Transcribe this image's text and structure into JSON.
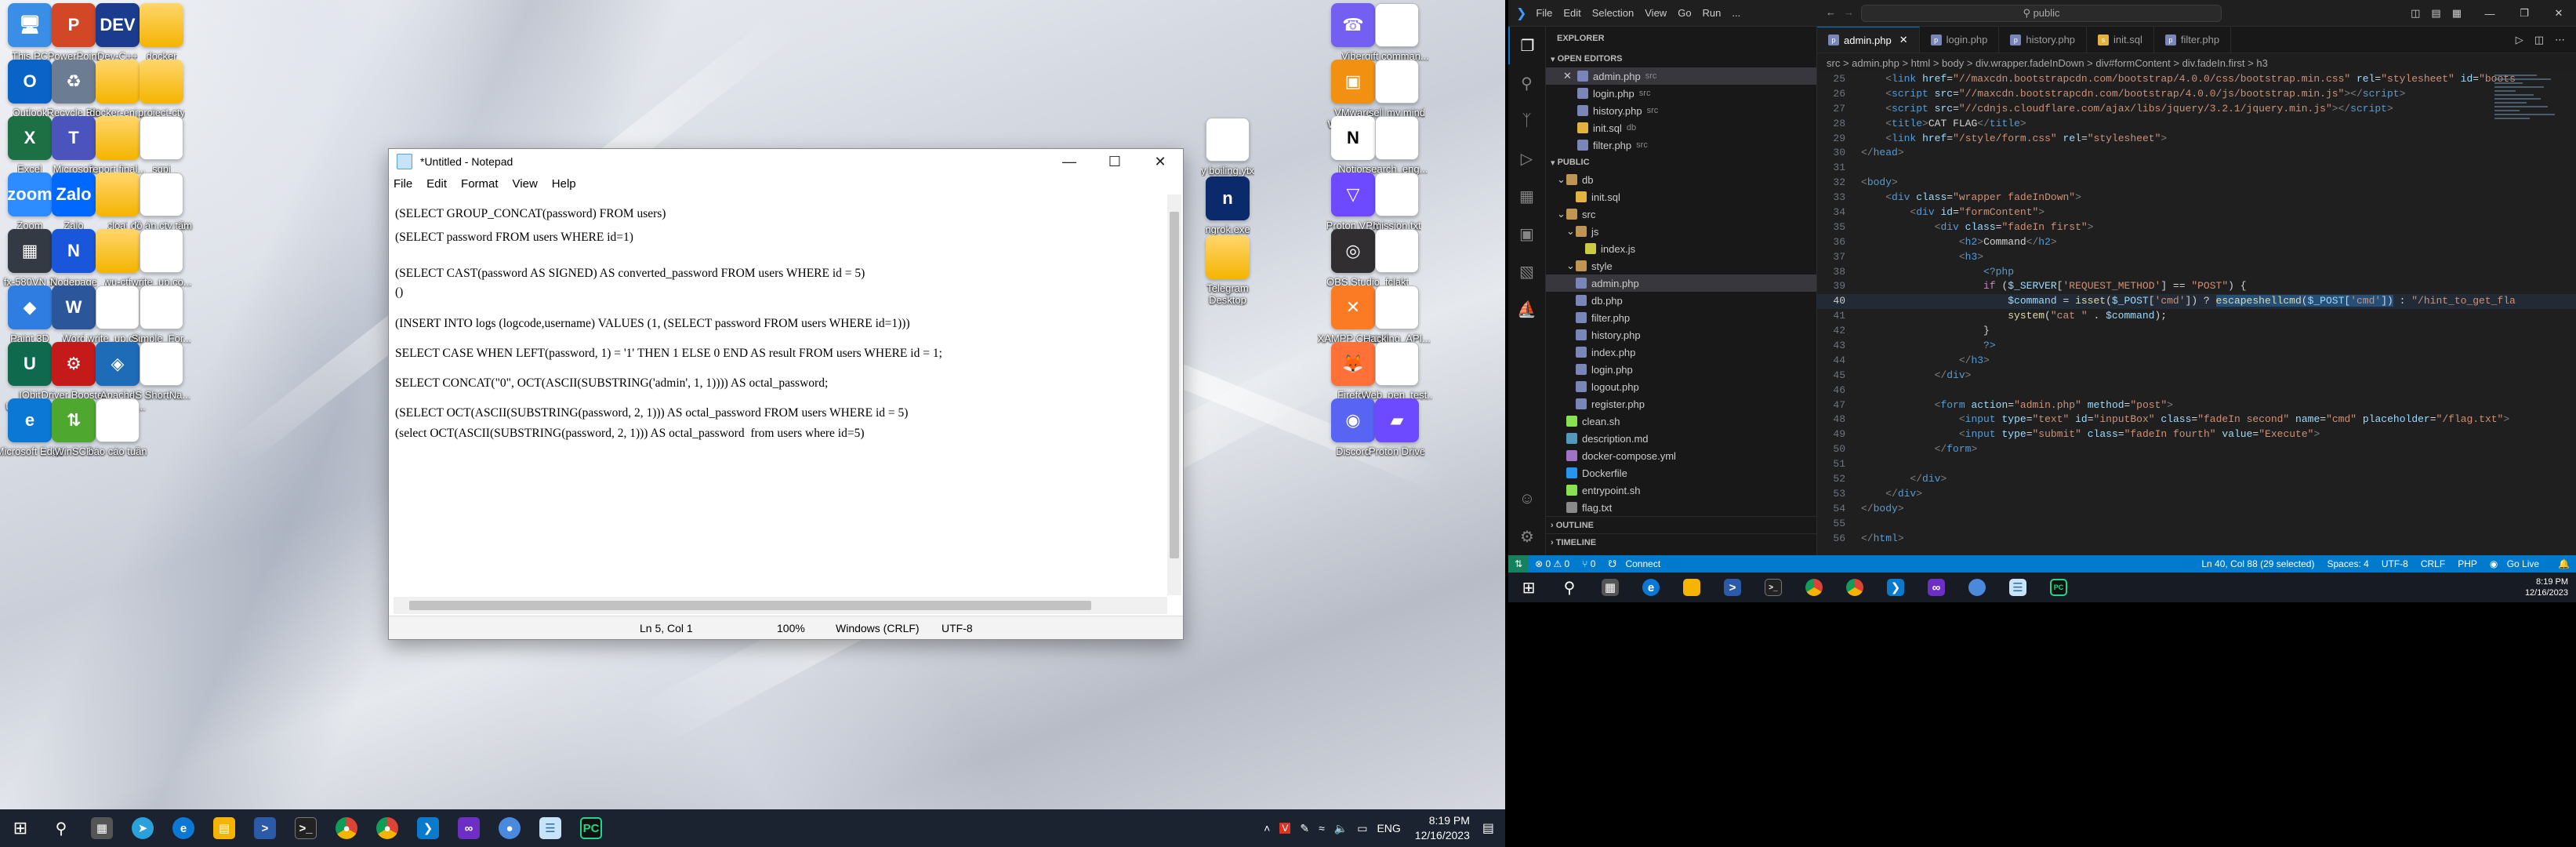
{
  "desktop": {
    "icons_left": [
      {
        "label": "This PC",
        "color": "#3a8ee6",
        "glyph": "🖥"
      },
      {
        "label": "PowerPoint",
        "color": "#d24726",
        "glyph": "P"
      },
      {
        "label": "Dev-C++",
        "color": "#1b3b8f",
        "glyph": "DEV"
      },
      {
        "label": "docker",
        "color": "folder",
        "glyph": ""
      },
      {
        "label": "Outlook",
        "color": "#0a64c8",
        "glyph": "O"
      },
      {
        "label": "Recycle Bin",
        "color": "#6b7c93",
        "glyph": "♻"
      },
      {
        "label": "docker-enj...",
        "color": "folder",
        "glyph": ""
      },
      {
        "label": "project-cty",
        "color": "folder",
        "glyph": ""
      },
      {
        "label": "Excel",
        "color": "#1d7044",
        "glyph": "X"
      },
      {
        "label": "Microsoft Teams classic",
        "color": "#4b53bc",
        "glyph": "T"
      },
      {
        "label": "report final...",
        "color": "folder",
        "glyph": ""
      },
      {
        "label": "sqpi",
        "color": "doc",
        "glyph": ""
      },
      {
        "label": "Zoom",
        "color": "#2d8cff",
        "glyph": "zoom"
      },
      {
        "label": "Zalo",
        "color": "#0068ff",
        "glyph": "Zalo"
      },
      {
        "label": "cloai",
        "color": "folder",
        "glyph": ""
      },
      {
        "label": "đồ án cty tấm duan",
        "color": "doc",
        "glyph": ""
      },
      {
        "label": "fx-580VN X Emulator",
        "color": "#333a44",
        "glyph": "▦"
      },
      {
        "label": "Nodepage",
        "color": "#1a56db",
        "glyph": "N"
      },
      {
        "label": "wu-ctf",
        "color": "folder",
        "glyph": ""
      },
      {
        "label": "write_up co...",
        "color": "doc",
        "glyph": ""
      },
      {
        "label": "Paint 3D",
        "color": "#2f7de1",
        "glyph": "◆"
      },
      {
        "label": "Word",
        "color": "#2b579a",
        "glyph": "W"
      },
      {
        "label": "write_up co...",
        "color": "doc",
        "glyph": ""
      },
      {
        "label": "Simple_For...",
        "color": "doc",
        "glyph": ""
      },
      {
        "label": "IObit Uninstaller",
        "color": "#0f6a4d",
        "glyph": "U"
      },
      {
        "label": "Driver Booster 10",
        "color": "#c41a1a",
        "glyph": "⚙"
      },
      {
        "label": "Apache NetBeans ...",
        "color": "#1e6bb8",
        "glyph": "◈"
      },
      {
        "label": "IS ShortNa...",
        "color": "doc",
        "glyph": ""
      },
      {
        "label": "Microsoft Edge",
        "color": "#0c78d6",
        "glyph": "e"
      },
      {
        "label": "WinSCP",
        "color": "#4ea72e",
        "glyph": "⇅"
      },
      {
        "label": "báo cáo tuần",
        "color": "doc",
        "glyph": ""
      }
    ],
    "icons_right": [
      {
        "label": "Viber",
        "color": "#7360f2",
        "glyph": "☎"
      },
      {
        "label": "gift comman...",
        "color": "doc",
        "glyph": ""
      },
      {
        "label": "VMware Workstati...",
        "color": "#f29111",
        "glyph": "▣"
      },
      {
        "label": "sell my mind",
        "color": "doc",
        "glyph": ""
      },
      {
        "label": "Notion",
        "color": "#ffffff",
        "glyph": "N"
      },
      {
        "label": "search_eng...",
        "color": "doc",
        "glyph": ""
      },
      {
        "label": "Proton VPN",
        "color": "#6d4aff",
        "glyph": "▽"
      },
      {
        "label": "mission.txt",
        "color": "doc",
        "glyph": ""
      },
      {
        "label": "OBS Studio",
        "color": "#302e31",
        "glyph": "◎"
      },
      {
        "label": "fclakt",
        "color": "doc",
        "glyph": ""
      },
      {
        "label": "XAMPP Control Panel",
        "color": "#fb7a24",
        "glyph": "✕"
      },
      {
        "label": "Hacking_API...",
        "color": "doc",
        "glyph": ""
      },
      {
        "label": "Firefox",
        "color": "#ff7139",
        "glyph": "🦊"
      },
      {
        "label": "Web_pen_test...",
        "color": "doc",
        "glyph": ""
      },
      {
        "label": "Discord",
        "color": "#5865f2",
        "glyph": "◉"
      },
      {
        "label": "Proton Drive",
        "color": "#6d4aff",
        "glyph": "▰"
      }
    ],
    "icons_mid": [
      {
        "label": "y boiling.ytx",
        "color": "doc",
        "glyph": ""
      },
      {
        "label": "ngrok.exe",
        "color": "#0b2a6b",
        "glyph": "n"
      },
      {
        "label": "Telegram Desktop",
        "color": "folder",
        "glyph": ""
      }
    ]
  },
  "notepad": {
    "title": "*Untitled - Notepad",
    "menu": [
      "File",
      "Edit",
      "Format",
      "View",
      "Help"
    ],
    "lines": [
      "(SELECT GROUP_CONCAT(password) FROM users)",
      "(SELECT password FROM users WHERE id=1)",
      "(SELECT CAST(password AS SIGNED) AS converted_password FROM users WHERE id = 5)",
      "()",
      "(INSERT INTO logs (logcode,username) VALUES (1, (SELECT password FROM users WHERE id=1)))",
      "SELECT CASE WHEN LEFT(password, 1) = '1' THEN 1 ELSE 0 END AS result FROM users WHERE id = 1;",
      "SELECT CONCAT(\"0\", OCT(ASCII(SUBSTRING('admin', 1, 1)))) AS octal_password;",
      "(SELECT OCT(ASCII(SUBSTRING(password, 2, 1))) AS octal_password FROM users WHERE id = 5)",
      "(select OCT(ASCII(SUBSTRING(password, 2, 1))) AS octal_password  from users where id=5)"
    ],
    "status": {
      "position": "Ln 5, Col 1",
      "zoom": "100%",
      "eol": "Windows (CRLF)",
      "encoding": "UTF-8"
    }
  },
  "taskbar_left": {
    "lang": "ENG",
    "time": "8:19 PM",
    "date": "12/16/2023"
  },
  "vscode": {
    "menu": [
      "File",
      "Edit",
      "Selection",
      "View",
      "Go",
      "Run",
      "..."
    ],
    "search": "public",
    "explorer_title": "EXPLORER",
    "open_editors_header": "OPEN EDITORS",
    "open_editors": [
      {
        "name": "admin.php",
        "dir": "src"
      },
      {
        "name": "login.php",
        "dir": "src"
      },
      {
        "name": "history.php",
        "dir": "src"
      },
      {
        "name": "init.sql",
        "dir": "db"
      },
      {
        "name": "filter.php",
        "dir": "src"
      }
    ],
    "public_header": "PUBLIC",
    "tree": [
      {
        "name": "db",
        "kind": "folder",
        "depth": 0
      },
      {
        "name": "init.sql",
        "kind": "sql",
        "depth": 1
      },
      {
        "name": "src",
        "kind": "folder",
        "depth": 0
      },
      {
        "name": "js",
        "kind": "folder",
        "depth": 1
      },
      {
        "name": "index.js",
        "kind": "js",
        "depth": 2
      },
      {
        "name": "style",
        "kind": "folder",
        "depth": 1
      },
      {
        "name": "admin.php",
        "kind": "php",
        "depth": 1
      },
      {
        "name": "db.php",
        "kind": "php",
        "depth": 1
      },
      {
        "name": "filter.php",
        "kind": "php",
        "depth": 1
      },
      {
        "name": "history.php",
        "kind": "php",
        "depth": 1
      },
      {
        "name": "index.php",
        "kind": "php",
        "depth": 1
      },
      {
        "name": "login.php",
        "kind": "php",
        "depth": 1
      },
      {
        "name": "logout.php",
        "kind": "php",
        "depth": 1
      },
      {
        "name": "register.php",
        "kind": "php",
        "depth": 1
      },
      {
        "name": "clean.sh",
        "kind": "sh",
        "depth": 0
      },
      {
        "name": "description.md",
        "kind": "md",
        "depth": 0
      },
      {
        "name": "docker-compose.yml",
        "kind": "yml",
        "depth": 0
      },
      {
        "name": "Dockerfile",
        "kind": "docker",
        "depth": 0
      },
      {
        "name": "entrypoint.sh",
        "kind": "sh",
        "depth": 0
      },
      {
        "name": "flag.txt",
        "kind": "txt",
        "depth": 0
      }
    ],
    "outline": "OUTLINE",
    "timeline": "TIMELINE",
    "tabs": [
      "admin.php",
      "login.php",
      "history.php",
      "init.sql",
      "filter.php"
    ],
    "breadcrumb": "src > admin.php > html > body > div.wrapper.fadeInDown > div#formContent > div.fadeIn.first > h3",
    "code": [
      {
        "n": "25",
        "html": "<span class='w'>    </span><span class='p'>&lt;</span><span class='t'>link</span> <span class='a'>href</span>=<span class='s'>\"//maxcdn.bootstrapcdn.com/bootstrap/4.0.0/css/bootstrap.min.css\"</span> <span class='a'>rel</span>=<span class='s'>\"stylesheet\"</span> <span class='a'>id</span>=<span class='s'>\"boots</span>"
      },
      {
        "n": "26",
        "html": "<span class='w'>    </span><span class='p'>&lt;</span><span class='t'>script</span> <span class='a'>src</span>=<span class='s'>\"//maxcdn.bootstrapcdn.com/bootstrap/4.0.0/js/bootstrap.min.js\"</span><span class='p'>&gt;&lt;/</span><span class='t'>script</span><span class='p'>&gt;</span>"
      },
      {
        "n": "27",
        "html": "<span class='w'>    </span><span class='p'>&lt;</span><span class='t'>script</span> <span class='a'>src</span>=<span class='s'>\"//cdnjs.cloudflare.com/ajax/libs/jquery/3.2.1/jquery.min.js\"</span><span class='p'>&gt;&lt;/</span><span class='t'>script</span><span class='p'>&gt;</span>"
      },
      {
        "n": "28",
        "html": "<span class='w'>    </span><span class='p'>&lt;</span><span class='t'>title</span><span class='p'>&gt;</span><span class='w'>CAT FLAG</span><span class='p'>&lt;/</span><span class='t'>title</span><span class='p'>&gt;</span>"
      },
      {
        "n": "29",
        "html": "<span class='w'>    </span><span class='p'>&lt;</span><span class='t'>link</span> <span class='a'>href</span>=<span class='s'>\"/style/form.css\"</span> <span class='a'>rel</span>=<span class='s'>\"stylesheet\"</span><span class='p'>&gt;</span>"
      },
      {
        "n": "30",
        "html": "<span class='p'>&lt;/</span><span class='t'>head</span><span class='p'>&gt;</span>"
      },
      {
        "n": "31",
        "html": ""
      },
      {
        "n": "32",
        "html": "<span class='p'>&lt;</span><span class='t'>body</span><span class='p'>&gt;</span>"
      },
      {
        "n": "33",
        "html": "<span class='w'>    </span><span class='p'>&lt;</span><span class='t'>div</span> <span class='a'>class</span>=<span class='s'>\"wrapper fadeInDown\"</span><span class='p'>&gt;</span>"
      },
      {
        "n": "34",
        "html": "<span class='w'>        </span><span class='p'>&lt;</span><span class='t'>div</span> <span class='a'>id</span>=<span class='s'>\"formContent\"</span><span class='p'>&gt;</span>"
      },
      {
        "n": "35",
        "html": "<span class='w'>            </span><span class='p'>&lt;</span><span class='t'>div</span> <span class='a'>class</span>=<span class='s'>\"fadeIn first\"</span><span class='p'>&gt;</span>"
      },
      {
        "n": "36",
        "html": "<span class='w'>                </span><span class='p'>&lt;</span><span class='t'>h2</span><span class='p'>&gt;</span><span class='w'>Command</span><span class='p'>&lt;/</span><span class='t'>h2</span><span class='p'>&gt;</span>"
      },
      {
        "n": "37",
        "html": "<span class='w'>                </span><span class='p'>&lt;</span><span class='t'>h3</span><span class='p'>&gt;</span>"
      },
      {
        "n": "38",
        "html": "<span class='w'>                    </span><span class='t'>&lt;?php</span>"
      },
      {
        "n": "39",
        "html": "<span class='w'>                    </span><span class='k'>if</span><span class='w'> (</span><span class='v'>$_SERVER</span><span class='w'>[</span><span class='s'>'REQUEST_METHOD'</span><span class='w'>] == </span><span class='s'>\"POST\"</span><span class='w'>) {</span>"
      },
      {
        "n": "40",
        "cur": true,
        "html": "<span class='w'>                        </span><span class='v'>$command</span><span class='w'> = </span><span class='f'>isset</span><span class='w'>(</span><span class='v'>$_POST</span><span class='w'>[</span><span class='s'>'cmd'</span><span class='w'>]) ? </span><span class='f' style='background:#264f78'>escapeshellcmd</span><span class='w' style='background:#264f78'>(</span><span class='v' style='background:#264f78'>$_POST</span><span class='w' style='background:#264f78'>[</span><span class='s' style='background:#264f78'>'cmd'</span><span class='w' style='background:#264f78'>])</span><span class='w'> : </span><span class='s'>\"/hint_to_get_fla</span>"
      },
      {
        "n": "41",
        "html": "<span class='w'>                        </span><span class='f'>system</span><span class='w'>(</span><span class='s'>\"cat \"</span><span class='w'> . </span><span class='v'>$command</span><span class='w'>);</span>"
      },
      {
        "n": "42",
        "html": "<span class='w'>                    }</span>"
      },
      {
        "n": "43",
        "html": "<span class='w'>                    </span><span class='t'>?&gt;</span>"
      },
      {
        "n": "44",
        "html": "<span class='w'>                </span><span class='p'>&lt;/</span><span class='t'>h3</span><span class='p'>&gt;</span>"
      },
      {
        "n": "45",
        "html": "<span class='w'>            </span><span class='p'>&lt;/</span><span class='t'>div</span><span class='p'>&gt;</span>"
      },
      {
        "n": "46",
        "html": ""
      },
      {
        "n": "47",
        "html": "<span class='w'>            </span><span class='p'>&lt;</span><span class='t'>form</span> <span class='a'>action</span>=<span class='s'>\"admin.php\"</span> <span class='a'>method</span>=<span class='s'>\"post\"</span><span class='p'>&gt;</span>"
      },
      {
        "n": "48",
        "html": "<span class='w'>                </span><span class='p'>&lt;</span><span class='t'>input</span> <span class='a'>type</span>=<span class='s'>\"text\"</span> <span class='a'>id</span>=<span class='s'>\"inputBox\"</span> <span class='a'>class</span>=<span class='s'>\"fadeIn second\"</span> <span class='a'>name</span>=<span class='s'>\"cmd\"</span> <span class='a'>placeholder</span>=<span class='s'>\"/flag.txt\"</span><span class='p'>&gt;</span>"
      },
      {
        "n": "49",
        "html": "<span class='w'>                </span><span class='p'>&lt;</span><span class='t'>input</span> <span class='a'>type</span>=<span class='s'>\"submit\"</span> <span class='a'>class</span>=<span class='s'>\"fadeIn fourth\"</span> <span class='a'>value</span>=<span class='s'>\"Execute\"</span><span class='p'>&gt;</span>"
      },
      {
        "n": "50",
        "html": "<span class='w'>            </span><span class='p'>&lt;/</span><span class='t'>form</span><span class='p'>&gt;</span>"
      },
      {
        "n": "51",
        "html": ""
      },
      {
        "n": "52",
        "html": "<span class='w'>        </span><span class='p'>&lt;/</span><span class='t'>div</span><span class='p'>&gt;</span>"
      },
      {
        "n": "53",
        "html": "<span class='w'>    </span><span class='p'>&lt;/</span><span class='t'>div</span><span class='p'>&gt;</span>"
      },
      {
        "n": "54",
        "html": "<span class='p'>&lt;/</span><span class='t'>body</span><span class='p'>&gt;</span>"
      },
      {
        "n": "55",
        "html": ""
      },
      {
        "n": "56",
        "html": "<span class='p'>&lt;/</span><span class='t'>html</span><span class='p'>&gt;</span>"
      }
    ],
    "status": {
      "problems": "⊗ 0 ⚠ 0",
      "ports": "⑂ 0",
      "connect": "Connect",
      "position": "Ln 40, Col 88 (29 selected)",
      "spaces": "Spaces: 4",
      "encoding": "UTF-8",
      "eol": "CRLF",
      "lang": "PHP",
      "golive": "Go Live"
    }
  },
  "taskbar_right": {
    "time": "8:19 PM",
    "date": "12/16/2023"
  }
}
